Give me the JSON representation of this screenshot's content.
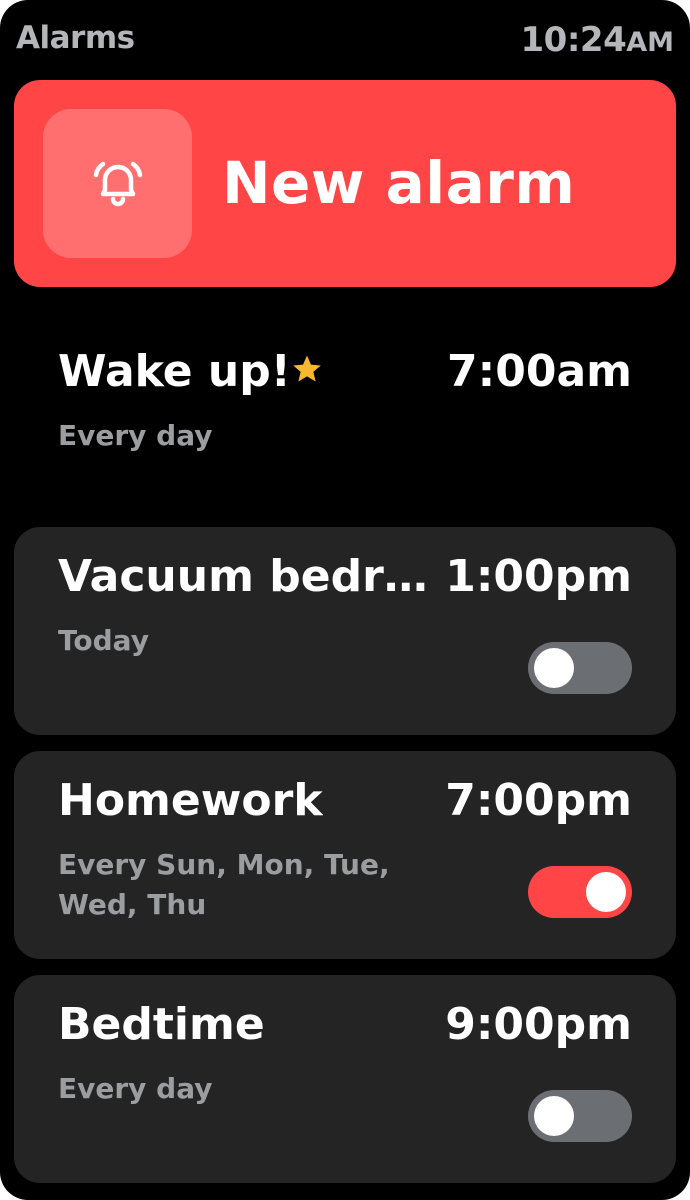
{
  "header": {
    "title": "Alarms",
    "clock_time": "10:24",
    "clock_ampm": "AM"
  },
  "new_alarm": {
    "label": "New alarm",
    "icon": "bell-ringing-icon",
    "color": "#ff4545"
  },
  "alarms": [
    {
      "name": "Wake up!",
      "time": "7:00am",
      "repeat": "Every day",
      "favorite": true,
      "favorite_icon": "star-icon"
    },
    {
      "name": "Vacuum bedro...",
      "time": "1:00pm",
      "repeat": "Today",
      "enabled": false
    },
    {
      "name": "Homework",
      "time": "7:00pm",
      "repeat": "Every Sun, Mon, Tue, Wed, Thu",
      "enabled": true
    },
    {
      "name": "Bedtime",
      "time": "9:00pm",
      "repeat": "Every day",
      "enabled": false
    }
  ],
  "colors": {
    "accent": "#ff4545",
    "card": "#242424",
    "toggle_off": "#6b6e73",
    "star": "#f5b82e"
  }
}
